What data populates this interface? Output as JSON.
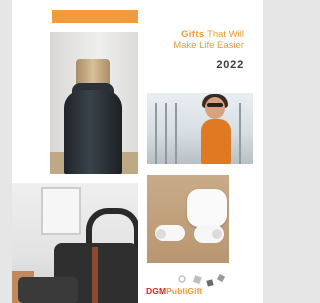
{
  "cover": {
    "title_bold": "Gifts",
    "title_rest_line1": "That Will",
    "title_line2": "Make Life Easier",
    "year": "2022"
  },
  "logo": {
    "part1": "DGM",
    "part2": "PubliGift"
  },
  "colors": {
    "accent": "#f39a3c",
    "logo_red": "#e2231a",
    "background": "#e6e6e6"
  }
}
